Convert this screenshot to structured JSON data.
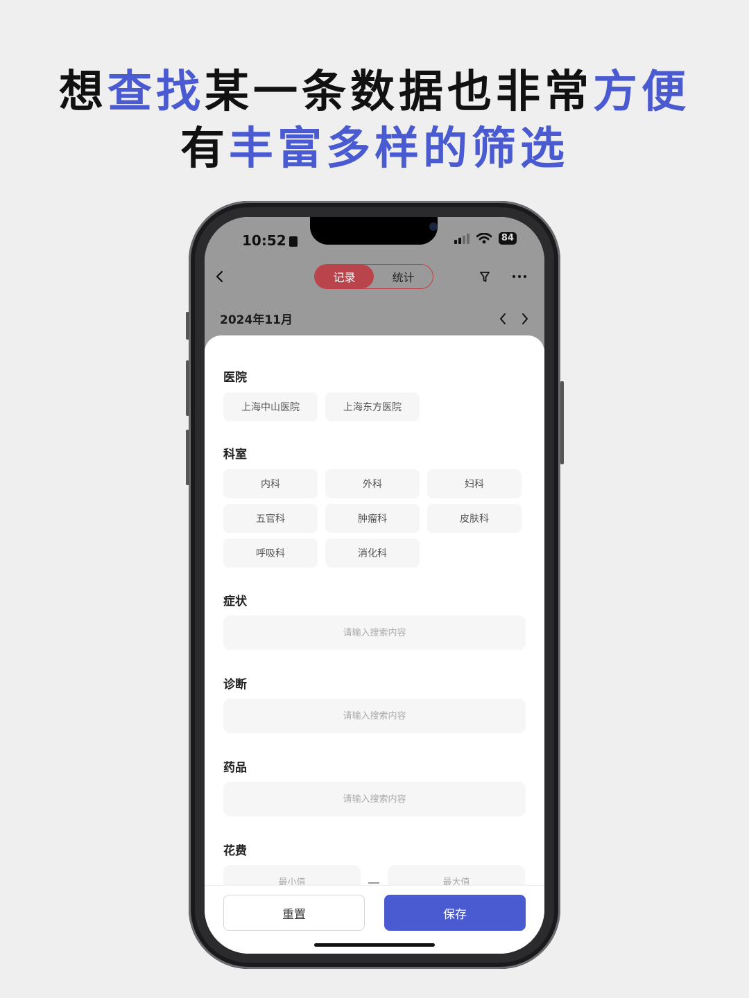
{
  "headline": {
    "line1": [
      {
        "text": "想",
        "color": "black"
      },
      {
        "text": "查找",
        "color": "blue"
      },
      {
        "text": "某一条数据也非常",
        "color": "black"
      },
      {
        "text": "方便",
        "color": "blue"
      }
    ],
    "line2": [
      {
        "text": "有",
        "color": "black"
      },
      {
        "text": "丰富多样的筛选",
        "color": "blue"
      }
    ]
  },
  "colors": {
    "accent": "#4a5ad0",
    "active_tab": "#b9444b",
    "page_bg": "#efefef"
  },
  "status_bar": {
    "time": "10:52",
    "battery": "84",
    "icons": [
      "signal-icon",
      "wifi-icon",
      "battery-icon"
    ]
  },
  "nav": {
    "back_icon": "chevron-left-icon",
    "tabs": [
      {
        "label": "记录",
        "active": true
      },
      {
        "label": "统计",
        "active": false
      }
    ],
    "filter_icon": "filter-icon",
    "more_icon": "more-icon"
  },
  "month": {
    "label": "2024年11月",
    "prev_icon": "chevron-left-icon",
    "next_icon": "chevron-right-icon"
  },
  "filters": {
    "hospital": {
      "title": "医院",
      "options": [
        "上海中山医院",
        "上海东方医院"
      ]
    },
    "department": {
      "title": "科室",
      "options": [
        "内科",
        "外科",
        "妇科",
        "五官科",
        "肿瘤科",
        "皮肤科",
        "呼吸科",
        "消化科"
      ]
    },
    "symptom": {
      "title": "症状",
      "placeholder": "请输入搜索内容"
    },
    "diagnosis": {
      "title": "诊断",
      "placeholder": "请输入搜索内容"
    },
    "medicine": {
      "title": "药品",
      "placeholder": "请输入搜索内容"
    },
    "cost": {
      "title": "花费",
      "min_placeholder": "最小值",
      "max_placeholder": "最大值"
    }
  },
  "footer": {
    "reset_label": "重置",
    "save_label": "保存"
  }
}
